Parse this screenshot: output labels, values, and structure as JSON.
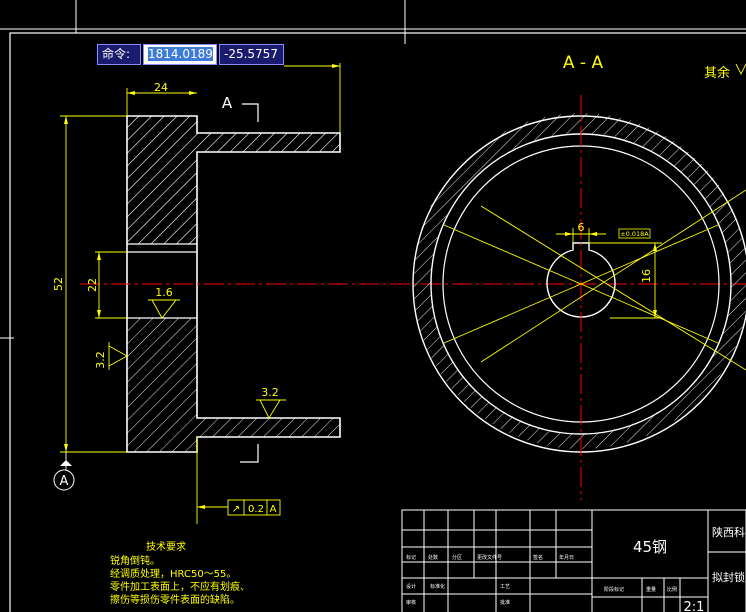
{
  "command_bar": {
    "label": "命令:",
    "x_value": "1814.0189",
    "y_value": "-25.5757"
  },
  "drawing": {
    "section_label": "A - A",
    "other_roughness": "其余",
    "view_letter": "A",
    "datum_letter": "A",
    "dimensions": {
      "width_top": "24",
      "height_total": "52",
      "bore": "22",
      "keyway_width": "6",
      "keyway_depth": "16",
      "keyway_callout": "±0.018A"
    },
    "roughness": {
      "bore": "1.6",
      "left_face": "3.2",
      "hub_face": "3.2"
    },
    "tolerance_frame": {
      "symbol": "↗",
      "value": "0.2",
      "datum": "A"
    }
  },
  "technical_requirements": {
    "title": "技术要求",
    "lines": [
      "锐角倒钝。",
      "经调质处理，HRC50～55。",
      "零件加工表面上，不应有划痕、",
      "擦伤等损伤零件表面的缺陷。"
    ]
  },
  "title_block": {
    "material": "45钢",
    "school": "陕西科",
    "part": "拟封锁",
    "scale": "2:1",
    "row_labels": [
      "标记",
      "处数",
      "分区",
      "更改文件号",
      "签名",
      "年月日"
    ],
    "row_labels2": [
      "设计",
      "标准化",
      "审核",
      "工艺",
      "批准"
    ],
    "stage_label": "阶段标记",
    "weight_label": "重量",
    "scale_label": "比例"
  }
}
